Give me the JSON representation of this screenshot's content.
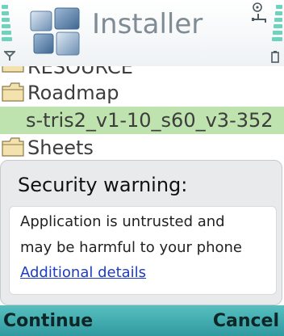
{
  "header": {
    "title": "Installer",
    "logo_icon": "installer-blocks-icon",
    "signal_icon": "antenna-icon",
    "battery_icon": "battery-icon",
    "connection_icon": "connection-icon",
    "indicator_color": "#6fd2bf"
  },
  "file_list": {
    "items": [
      {
        "label": "RESOURCE",
        "icon": "folder-icon",
        "selected": false
      },
      {
        "label": "Roadmap",
        "icon": "folder-icon",
        "selected": false
      },
      {
        "label": "s-tris2_v1-10_s60_v3-352",
        "icon": "file",
        "selected": true
      },
      {
        "label": "Sheets",
        "icon": "folder-icon",
        "selected": false
      }
    ],
    "highlight_color": "#bfe3ae"
  },
  "dialog": {
    "heading": "Security warning:",
    "line1": "Application is untrusted and",
    "line2": "may be harmful to your phone",
    "link": "Additional details",
    "link_color": "#1d3cc4"
  },
  "softkeys": {
    "left": "Continue",
    "right": "Cancel",
    "bar_color": "#3aa8ac"
  }
}
